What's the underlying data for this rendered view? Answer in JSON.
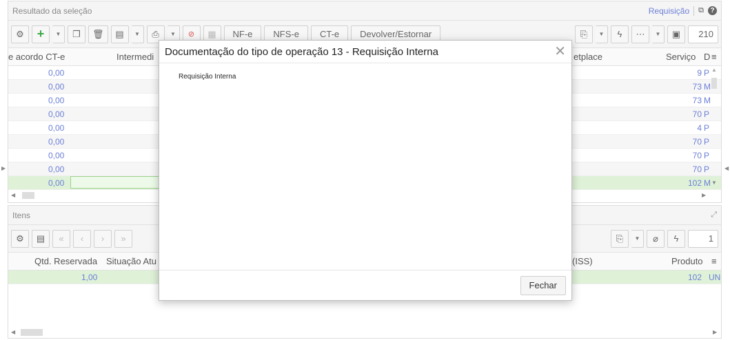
{
  "top_panel": {
    "title": "Resultado da seleção",
    "requisicao_link": "Requisição",
    "toolbar": {
      "nfe": "NF-e",
      "nfse": "NFS-e",
      "cte": "CT-e",
      "devolver": "Devolver/Estornar",
      "counter": "210"
    },
    "columns": {
      "acordo": "e acordo CT-e",
      "intermediador": "Intermedi",
      "marketplace": "etplace",
      "servico": "Serviço",
      "d": "D"
    },
    "rows": [
      {
        "acordo": "0,00",
        "servico": "9",
        "d": "P"
      },
      {
        "acordo": "0,00",
        "servico": "73",
        "d": "M"
      },
      {
        "acordo": "0,00",
        "servico": "73",
        "d": "M"
      },
      {
        "acordo": "0,00",
        "servico": "70",
        "d": "P"
      },
      {
        "acordo": "0,00",
        "servico": "4",
        "d": "P"
      },
      {
        "acordo": "0,00",
        "servico": "70",
        "d": "P"
      },
      {
        "acordo": "0,00",
        "servico": "70",
        "d": "P"
      },
      {
        "acordo": "0,00",
        "servico": "70",
        "d": "P"
      },
      {
        "acordo": "0,00",
        "servico": "102",
        "d": "M"
      }
    ]
  },
  "bottom_panel": {
    "title": "Itens",
    "counter": "1",
    "columns": {
      "qtd": "Qtd. Reservada",
      "situacao": "Situação Atu",
      "iss": "(ISS)",
      "produto": "Produto"
    },
    "row": {
      "qtd": "1,00",
      "produto": "102",
      "un": "UN"
    }
  },
  "modal": {
    "title": "Documentação do tipo de operação 13 - Requisição Interna",
    "body": "Requisição Interna",
    "close_label": "Fechar"
  },
  "icons": {
    "gear": "gear-icon",
    "add": "plus-icon",
    "copy": "copy-icon",
    "delete": "trash-icon",
    "list": "list-icon",
    "print": "printer-icon",
    "lightning": "lightning-icon",
    "more": "more-icon",
    "save": "save-icon",
    "attach": "paperclip-icon",
    "help": "help-icon",
    "expand": "expand-icon"
  },
  "colors": {
    "link": "#6b7fd7",
    "selected_row": "#dff2d8",
    "add_green": "#39a845"
  }
}
